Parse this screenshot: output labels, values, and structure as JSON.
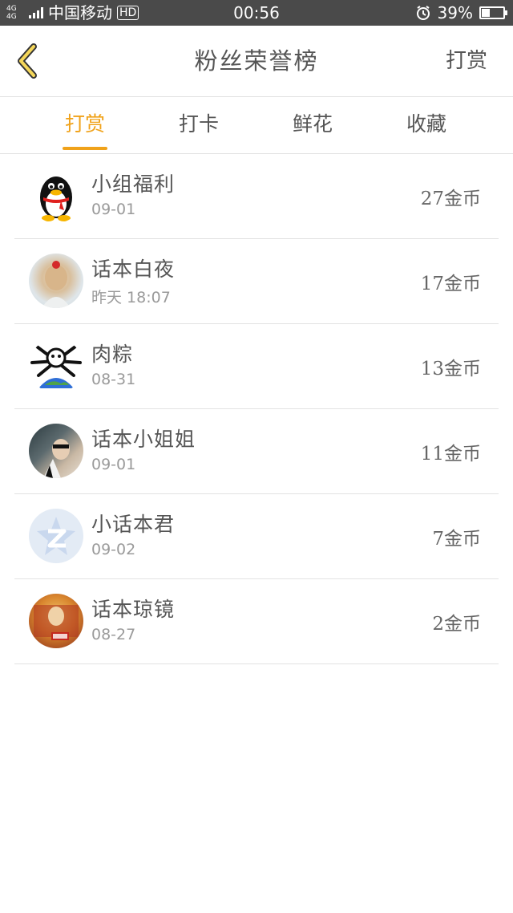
{
  "status_bar": {
    "network": "4G 4G",
    "carrier": "中国移动",
    "hd": "HD",
    "time": "00:56",
    "battery": "39%",
    "battery_level": 0.39
  },
  "header": {
    "title": "粉丝荣誉榜",
    "action": "打赏",
    "accent_color": "#f0a21a"
  },
  "tabs": [
    {
      "label": "打赏",
      "active": true
    },
    {
      "label": "打卡",
      "active": false
    },
    {
      "label": "鲜花",
      "active": false
    },
    {
      "label": "收藏",
      "active": false
    }
  ],
  "list": [
    {
      "name": "小组福利",
      "date": "09-01",
      "amount": "27金币",
      "avatar": "qq-penguin-avatar"
    },
    {
      "name": "话本白夜",
      "date": "昨天  18:07",
      "amount": "17金币",
      "avatar": "photo-avatar"
    },
    {
      "name": "肉粽",
      "date": "08-31",
      "amount": "13金币",
      "avatar": "cartoon-avatar"
    },
    {
      "name": "话本小姐姐",
      "date": "09-01",
      "amount": "11金币",
      "avatar": "photo-avatar"
    },
    {
      "name": "小话本君",
      "date": "09-02",
      "amount": "7金币",
      "avatar": "z-logo-avatar"
    },
    {
      "name": "话本琼镜",
      "date": "08-27",
      "amount": "2金币",
      "avatar": "photo-avatar"
    }
  ]
}
